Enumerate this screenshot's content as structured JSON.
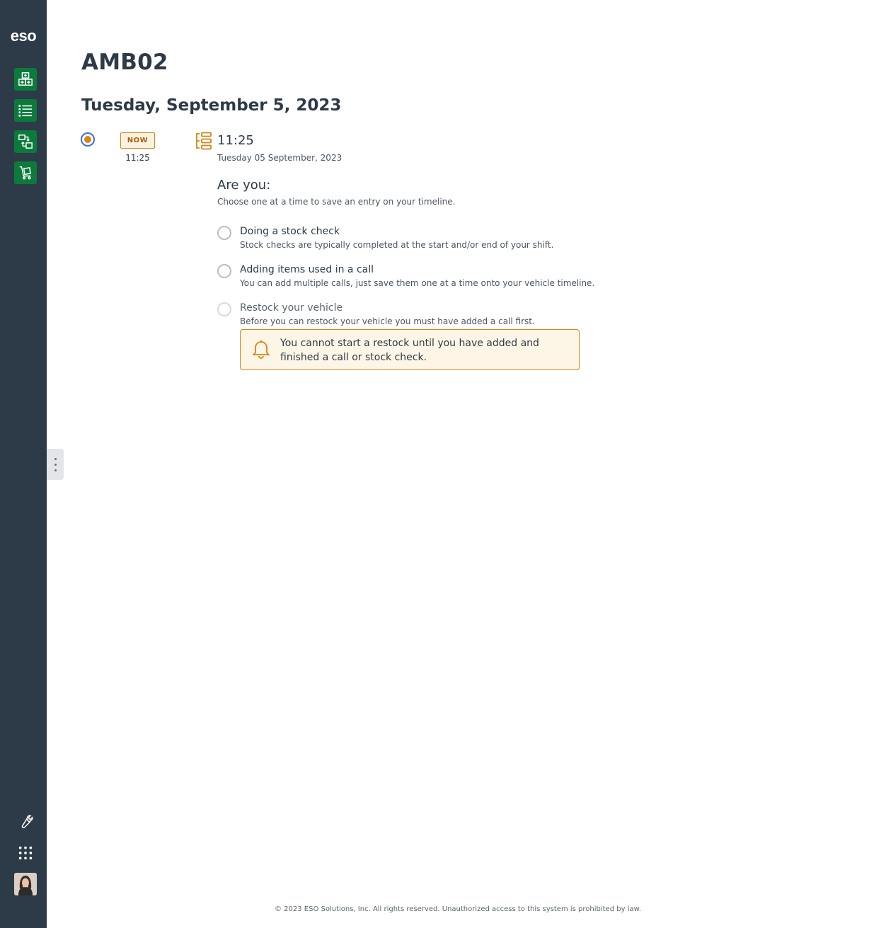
{
  "app": {
    "logo_text": "eso"
  },
  "sidebar": {
    "nav_items": [
      {
        "icon": "inventory-grid-icon",
        "color": "#0b7a3b"
      },
      {
        "icon": "list-icon",
        "color": "#0b7a3b"
      },
      {
        "icon": "transfer-icon",
        "color": "#0b7a3b"
      },
      {
        "icon": "cart-icon",
        "color": "#0b7a3b"
      }
    ],
    "tools": [
      {
        "icon": "wrench-icon"
      },
      {
        "icon": "app-grid-icon"
      },
      {
        "icon": "avatar"
      }
    ]
  },
  "main": {
    "title": "AMB02",
    "date_heading": "Tuesday, September 5, 2023",
    "timeline": {
      "now_badge": "NOW",
      "now_time": "11:25",
      "entry_time": "11:25",
      "entry_date": "Tuesday 05 September, 2023"
    },
    "question": {
      "title": "Are you:",
      "subtitle": "Choose one at a time to save an entry on your timeline."
    },
    "options": [
      {
        "label": "Doing a stock check",
        "description": "Stock checks are typically completed at the start and/or end of your shift.",
        "enabled": true
      },
      {
        "label": "Adding items used in a call",
        "description": "You can add multiple calls, just save them one at a time onto your vehicle timeline.",
        "enabled": true
      },
      {
        "label": "Restock your vehicle",
        "description": "Before you can restock your vehicle you must have added a call first.",
        "enabled": false
      }
    ],
    "alert": {
      "icon": "bell-icon",
      "text": "You cannot start a restock until you have added and finished a call or stock check."
    }
  },
  "footer": {
    "text": "© 2023 ESO Solutions, Inc. All rights reserved. Unauthorized access to this system is prohibited by law."
  },
  "colors": {
    "sidebar": "#2d3a48",
    "nav_green": "#0b7a3b",
    "accent_orange": "#d68418",
    "radio_selected": "#3a6fd8"
  }
}
